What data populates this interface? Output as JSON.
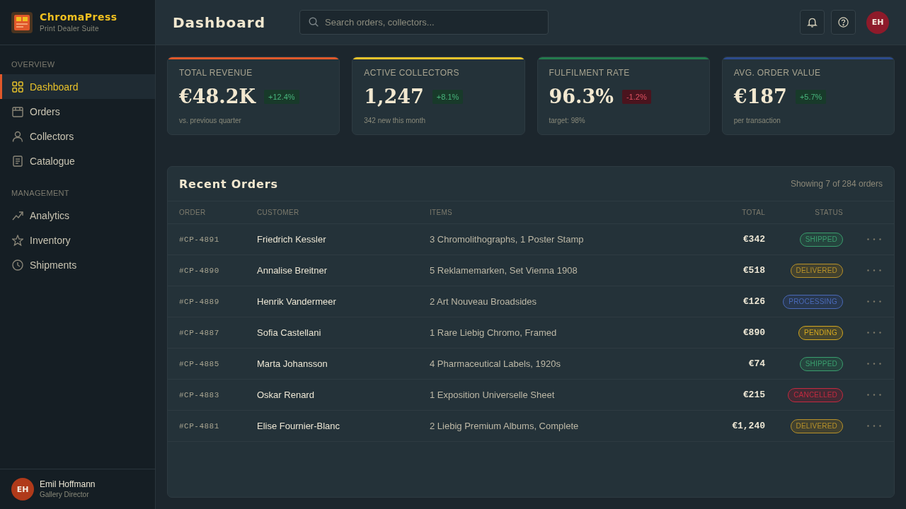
{
  "brand": {
    "name": "ChromaPress",
    "tagline": "Print Dealer Suite"
  },
  "sidebar": {
    "sections": [
      {
        "heading": "OVERVIEW",
        "items": [
          {
            "label": "Dashboard",
            "selected": true
          },
          {
            "label": "Orders",
            "selected": false
          },
          {
            "label": "Collectors",
            "selected": false
          },
          {
            "label": "Catalogue",
            "selected": false
          }
        ]
      },
      {
        "heading": "MANAGEMENT",
        "items": [
          {
            "label": "Analytics",
            "selected": false
          },
          {
            "label": "Inventory",
            "selected": false
          },
          {
            "label": "Shipments",
            "selected": false
          }
        ]
      }
    ],
    "user": {
      "initials": "EH",
      "name": "Emil Hoffmann",
      "role": "Gallery Director"
    }
  },
  "header": {
    "title": "Dashboard",
    "search": {
      "placeholder": "Search orders, collectors..."
    },
    "avatar_initials": "EH"
  },
  "stats": [
    {
      "label": "TOTAL REVENUE",
      "value": "€48.2K",
      "change": "+12.4%",
      "positive": true,
      "note": "vs. previous quarter",
      "color": "#e0582a"
    },
    {
      "label": "ACTIVE COLLECTORS",
      "value": "1,247",
      "change": "+8.1%",
      "positive": true,
      "note": "342 new this month",
      "color": "#e8c22a"
    },
    {
      "label": "FULFILMENT RATE",
      "value": "96.3%",
      "change": "-1.2%",
      "positive": false,
      "note": "target: 98%",
      "color": "#237a4c"
    },
    {
      "label": "AVG. ORDER VALUE",
      "value": "€187",
      "change": "+5.7%",
      "positive": true,
      "note": "per transaction",
      "color": "#2c4a8c"
    }
  ],
  "orders": {
    "title": "Recent Orders",
    "summary": "Showing 7 of 284 orders",
    "columns": [
      "ORDER",
      "CUSTOMER",
      "ITEMS",
      "TOTAL",
      "STATUS"
    ],
    "rows": [
      {
        "order": "#CP-4891",
        "customer": "Friedrich Kessler",
        "items": "3 Chromolithographs, 1 Poster Stamp",
        "total": "€342",
        "status": {
          "label": "SHIPPED",
          "color": "#3a9e6e"
        }
      },
      {
        "order": "#CP-4890",
        "customer": "Annalise Breitner",
        "items": "5 Reklamemarken, Set Vienna 1908",
        "total": "€518",
        "status": {
          "label": "DELIVERED",
          "color": "#b8922a"
        }
      },
      {
        "order": "#CP-4889",
        "customer": "Henrik Vandermeer",
        "items": "2 Art Nouveau Broadsides",
        "total": "€126",
        "status": {
          "label": "PROCESSING",
          "color": "#4a6ab8"
        }
      },
      {
        "order": "#CP-4887",
        "customer": "Sofia Castellani",
        "items": "1 Rare Liebig Chromo, Framed",
        "total": "€890",
        "status": {
          "label": "PENDING",
          "color": "#d4a820"
        }
      },
      {
        "order": "#CP-4885",
        "customer": "Marta Johansson",
        "items": "4 Pharmaceutical Labels, 1920s",
        "total": "€74",
        "status": {
          "label": "SHIPPED",
          "color": "#3a9e6e"
        }
      },
      {
        "order": "#CP-4883",
        "customer": "Oskar Renard",
        "items": "1 Exposition Universelle Sheet",
        "total": "€215",
        "status": {
          "label": "CANCELLED",
          "color": "#c42a40"
        }
      },
      {
        "order": "#CP-4881",
        "customer": "Elise Fournier-Blanc",
        "items": "2 Liebig Premium Albums, Complete",
        "total": "€1,240",
        "status": {
          "label": "DELIVERED",
          "color": "#b8922a"
        }
      }
    ]
  }
}
